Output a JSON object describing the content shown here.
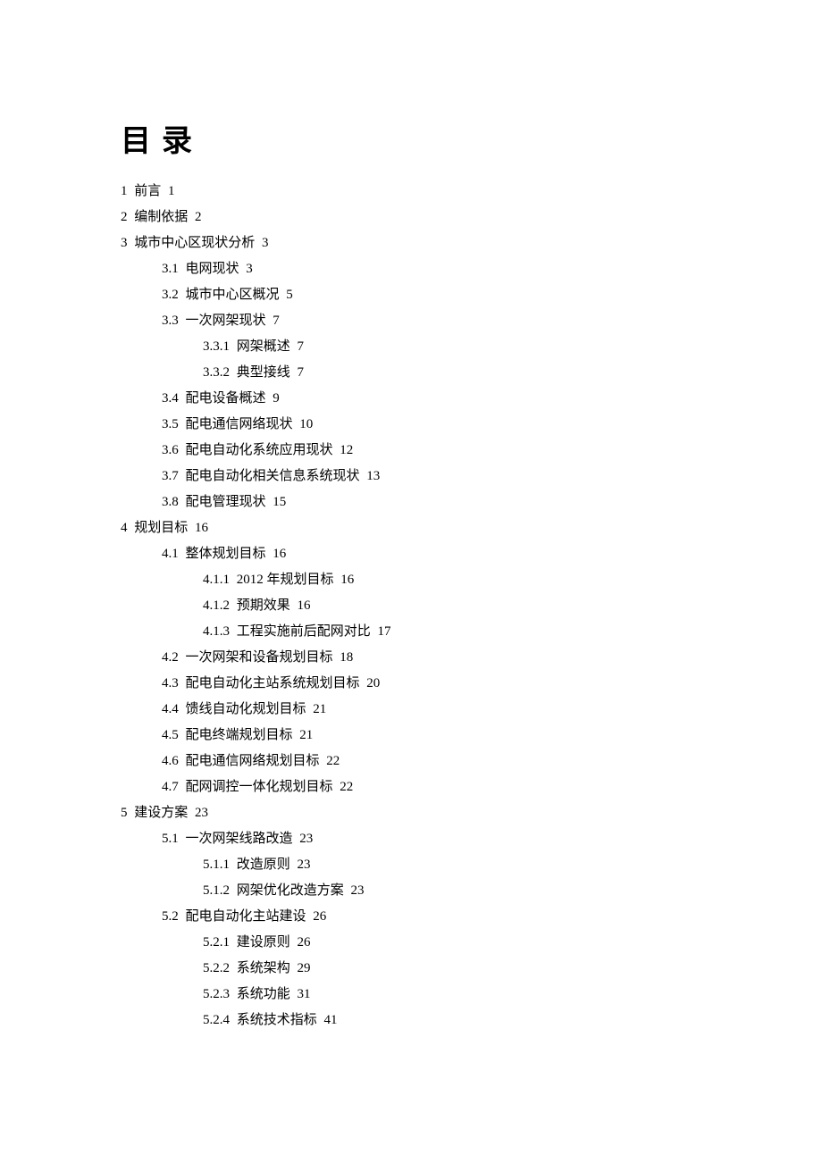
{
  "title": "目录",
  "toc": [
    {
      "level": 1,
      "num": "1",
      "text": "前言",
      "page": "1"
    },
    {
      "level": 1,
      "num": "2",
      "text": "编制依据",
      "page": "2"
    },
    {
      "level": 1,
      "num": "3",
      "text": "城市中心区现状分析",
      "page": "3"
    },
    {
      "level": 2,
      "num": "3.1",
      "text": "电网现状",
      "page": "3"
    },
    {
      "level": 2,
      "num": "3.2",
      "text": "城市中心区概况",
      "page": "5"
    },
    {
      "level": 2,
      "num": "3.3",
      "text": "一次网架现状",
      "page": "7"
    },
    {
      "level": 3,
      "num": "3.3.1",
      "text": "网架概述",
      "page": "7"
    },
    {
      "level": 3,
      "num": "3.3.2",
      "text": "典型接线",
      "page": "7"
    },
    {
      "level": 2,
      "num": "3.4",
      "text": "配电设备概述",
      "page": "9"
    },
    {
      "level": 2,
      "num": "3.5",
      "text": "配电通信网络现状",
      "page": "10"
    },
    {
      "level": 2,
      "num": "3.6",
      "text": "配电自动化系统应用现状",
      "page": "12"
    },
    {
      "level": 2,
      "num": "3.7",
      "text": "配电自动化相关信息系统现状",
      "page": "13"
    },
    {
      "level": 2,
      "num": "3.8",
      "text": "配电管理现状",
      "page": "15"
    },
    {
      "level": 1,
      "num": "4",
      "text": "规划目标",
      "page": "16"
    },
    {
      "level": 2,
      "num": "4.1",
      "text": "整体规划目标",
      "page": "16"
    },
    {
      "level": 3,
      "num": "4.1.1",
      "text": "2012 年规划目标",
      "page": "16"
    },
    {
      "level": 3,
      "num": "4.1.2",
      "text": "预期效果",
      "page": "16"
    },
    {
      "level": 3,
      "num": "4.1.3",
      "text": "工程实施前后配网对比",
      "page": "17"
    },
    {
      "level": 2,
      "num": "4.2",
      "text": "一次网架和设备规划目标",
      "page": "18"
    },
    {
      "level": 2,
      "num": "4.3",
      "text": "配电自动化主站系统规划目标",
      "page": "20"
    },
    {
      "level": 2,
      "num": "4.4",
      "text": "馈线自动化规划目标",
      "page": "21"
    },
    {
      "level": 2,
      "num": "4.5",
      "text": "配电终端规划目标",
      "page": "21"
    },
    {
      "level": 2,
      "num": "4.6",
      "text": "配电通信网络规划目标",
      "page": "22"
    },
    {
      "level": 2,
      "num": "4.7",
      "text": "配网调控一体化规划目标",
      "page": "22"
    },
    {
      "level": 1,
      "num": "5",
      "text": "建设方案",
      "page": "23"
    },
    {
      "level": 2,
      "num": "5.1",
      "text": "一次网架线路改造",
      "page": "23"
    },
    {
      "level": 3,
      "num": "5.1.1",
      "text": "改造原则",
      "page": "23"
    },
    {
      "level": 3,
      "num": "5.1.2",
      "text": "网架优化改造方案",
      "page": "23"
    },
    {
      "level": 2,
      "num": "5.2",
      "text": "配电自动化主站建设",
      "page": "26"
    },
    {
      "level": 3,
      "num": "5.2.1",
      "text": "建设原则",
      "page": "26"
    },
    {
      "level": 3,
      "num": "5.2.2",
      "text": "系统架构",
      "page": "29"
    },
    {
      "level": 3,
      "num": "5.2.3",
      "text": "系统功能",
      "page": "31"
    },
    {
      "level": 3,
      "num": "5.2.4",
      "text": "系统技术指标",
      "page": "41"
    }
  ]
}
